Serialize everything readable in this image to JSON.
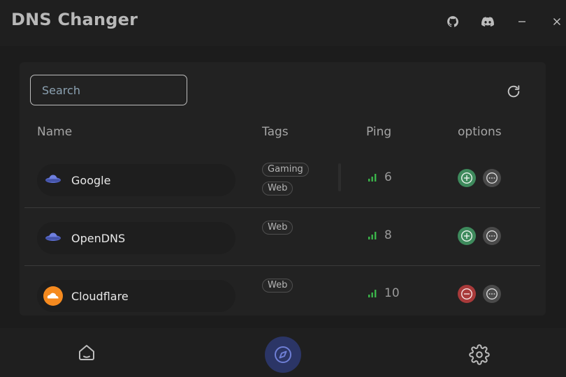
{
  "app": {
    "title": "DNS Changer"
  },
  "window_controls": [
    {
      "icon": "github-icon"
    },
    {
      "icon": "discord-icon"
    },
    {
      "icon": "minimize-icon"
    },
    {
      "icon": "close-icon"
    }
  ],
  "search": {
    "placeholder": "Search",
    "value": ""
  },
  "columns": {
    "name": "Name",
    "tags": "Tags",
    "ping": "Ping",
    "options": "options"
  },
  "servers": [
    {
      "name": "Google",
      "icon": "google-dns-icon",
      "tags": [
        "Gaming",
        "Web"
      ],
      "ping": "6",
      "action": "add",
      "action_color": "#3e8a5c"
    },
    {
      "name": "OpenDNS",
      "icon": "opendns-icon",
      "tags": [
        "Web"
      ],
      "ping": "8",
      "action": "add",
      "action_color": "#3e8a5c"
    },
    {
      "name": "Cloudflare",
      "icon": "cloudflare-icon",
      "tags": [
        "Web"
      ],
      "ping": "10",
      "action": "remove",
      "action_color": "#a83a3a"
    }
  ],
  "bottom_nav": [
    {
      "icon": "home-icon",
      "active": false
    },
    {
      "icon": "compass-icon",
      "active": true
    },
    {
      "icon": "settings-gear-icon",
      "active": false
    }
  ],
  "colors": {
    "accent": "#2b3566",
    "ping_good": "#3bb54a",
    "add_button": "#3e8a5c",
    "remove_button": "#a83a3a"
  }
}
